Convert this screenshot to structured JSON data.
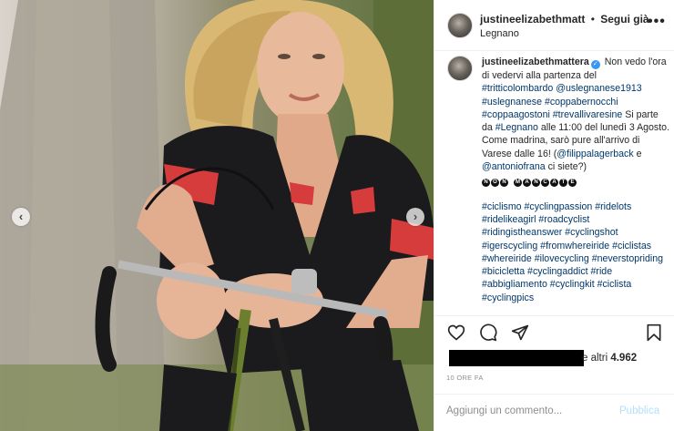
{
  "post": {
    "username": "justineelizabethmatt",
    "separator": "•",
    "follow_label": "Segui già",
    "location": "Legnano",
    "more_icon": "more-horizontal-icon"
  },
  "caption": {
    "username": "justineelizabethmattera",
    "verified_icon": "verified-check-icon",
    "lines": [
      "Non vedo l'ora di vedervi alla partenza del",
      "#tritticolombardo",
      "@uslegnanese1913",
      "#uslegnanese",
      "#coppabernocchi",
      "#coppaagostoni",
      "#trevallivaresine",
      "Si parte da",
      "#Legnano",
      "alle 11:00 del lunedì 3 Agosto. Come madrina, sarò pure all'arrivo di Varese dalle 16! (",
      "@filippalagerback",
      "e",
      "@antoniofrana",
      "ci siete?)"
    ],
    "emoji_letters": [
      "N",
      "O",
      "N",
      "",
      "M",
      "A",
      "N",
      "C",
      "A",
      "T",
      "E"
    ],
    "hashtags": "#ciclismo #cyclingpassion #ridelots #ridelikeagirl #roadcyclist #ridingistheanswer #cyclingshot #igerscycling #fromwhereiride #ciclistas #whereiride #ilovecycling #neverstopriding #bicicletta #cyclingaddict #ride #abbigliamento #cyclingkit #ciclista #cyclingpics"
  },
  "actions": {
    "like_icon": "heart-icon",
    "comment_icon": "comment-bubble-icon",
    "share_icon": "paper-plane-icon",
    "save_icon": "bookmark-icon"
  },
  "likes": {
    "prefix": "e altri",
    "count": "4.962"
  },
  "timestamp": "10 ORE FA",
  "comment": {
    "placeholder": "Aggiungi un commento...",
    "publish_label": "Pubblica"
  },
  "carousel": {
    "prev_icon": "chevron-left-icon",
    "next_icon": "chevron-right-icon"
  },
  "colors": {
    "link": "#00376b",
    "verified": "#3897f0",
    "publish_disabled": "#b2dffc",
    "muted": "#8e8e8e"
  }
}
